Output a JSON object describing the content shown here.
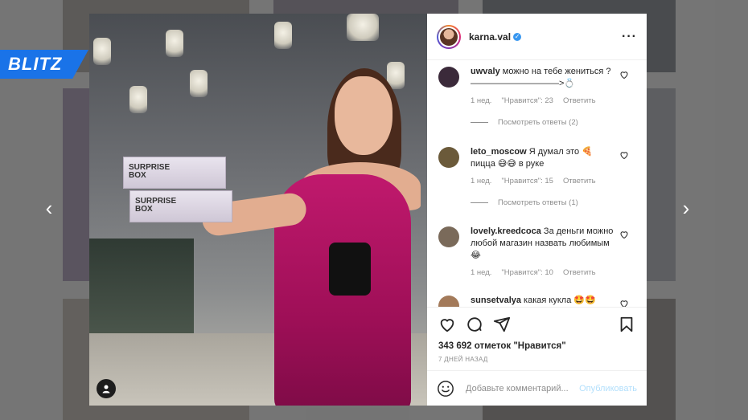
{
  "logo": {
    "text": "BLITZ"
  },
  "nav": {
    "prev": "‹",
    "next": "›"
  },
  "post": {
    "boxes": [
      {
        "line1": "SURPRISE",
        "line2": "BOX"
      },
      {
        "line1": "SURPRISE",
        "line2": "BOX"
      }
    ]
  },
  "header": {
    "username": "karna.val",
    "verified_mark": "✓",
    "more": "···"
  },
  "comments": [
    {
      "username": "uwvaly",
      "text": "можно на тебе жениться ? ——————————>💍",
      "time": "1 нед.",
      "likes": "\"Нравится\": 23",
      "reply": "Ответить",
      "view_replies": "Посмотреть ответы (2)",
      "avatar_color": "#3b2a3a"
    },
    {
      "username": "leto_moscow",
      "text": "Я думал это 🍕 пицца 😅😅 в руке",
      "time": "1 нед.",
      "likes": "\"Нравится\": 15",
      "reply": "Ответить",
      "view_replies": "Посмотреть ответы (1)",
      "avatar_color": "#6b5a3a"
    },
    {
      "username": "lovely.kreedcoca",
      "text": "За деньги можно любой магазин назвать любимым 😂",
      "time": "1 нед.",
      "likes": "\"Нравится\": 10",
      "reply": "Ответить",
      "view_replies": "",
      "avatar_color": "#7a6a5a"
    },
    {
      "username": "sunsetvalya",
      "text": "какая кукла 🤩🤩",
      "time": "",
      "likes": "",
      "reply": "",
      "view_replies": "",
      "avatar_color": "#a37a5a"
    }
  ],
  "actions": {
    "likes_text": "343 692 отметок \"Нравится\"",
    "date": "7 ДНЕЙ НАЗАД"
  },
  "add_comment": {
    "placeholder": "Добавьте комментарий...",
    "publish": "Опубликовать"
  }
}
